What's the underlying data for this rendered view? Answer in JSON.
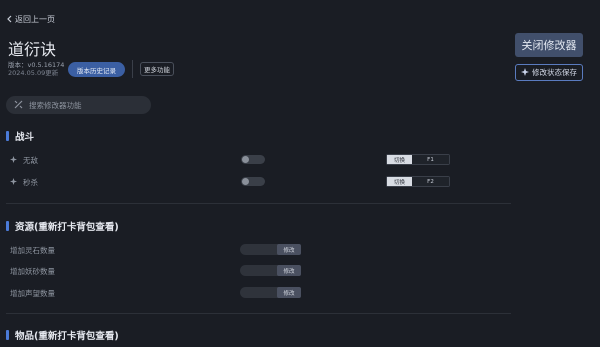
{
  "nav": {
    "back_label": "返回上一页"
  },
  "header": {
    "title": "道衍诀",
    "version": "版本：v0.5.16174",
    "date": "2024.05.09更新",
    "history_button": "版本历史记录",
    "more_button": "更多功能"
  },
  "actions": {
    "close_button": "关闭修改器",
    "save_button": "修改状态保存"
  },
  "search": {
    "placeholder": "搜索修改器功能"
  },
  "sections": {
    "battle": {
      "title": "战斗",
      "rows": [
        {
          "label": "无敌",
          "toggle_on": false,
          "switch_label": "切换",
          "hotkey": "F1"
        },
        {
          "label": "秒杀",
          "toggle_on": false,
          "switch_label": "切换",
          "hotkey": "F2"
        }
      ]
    },
    "resources": {
      "title": "资源(重新打卡背包查看)",
      "rows": [
        {
          "label": "增加灵石数量",
          "button": "修改"
        },
        {
          "label": "增加妖砂数量",
          "button": "修改"
        },
        {
          "label": "增加声望数量",
          "button": "修改"
        }
      ]
    },
    "items": {
      "title": "物品(重新打卡背包查看)"
    }
  },
  "colors": {
    "accent": "#4b7bd8",
    "background": "#1a1d24",
    "history_button": "#3b5fa3"
  }
}
